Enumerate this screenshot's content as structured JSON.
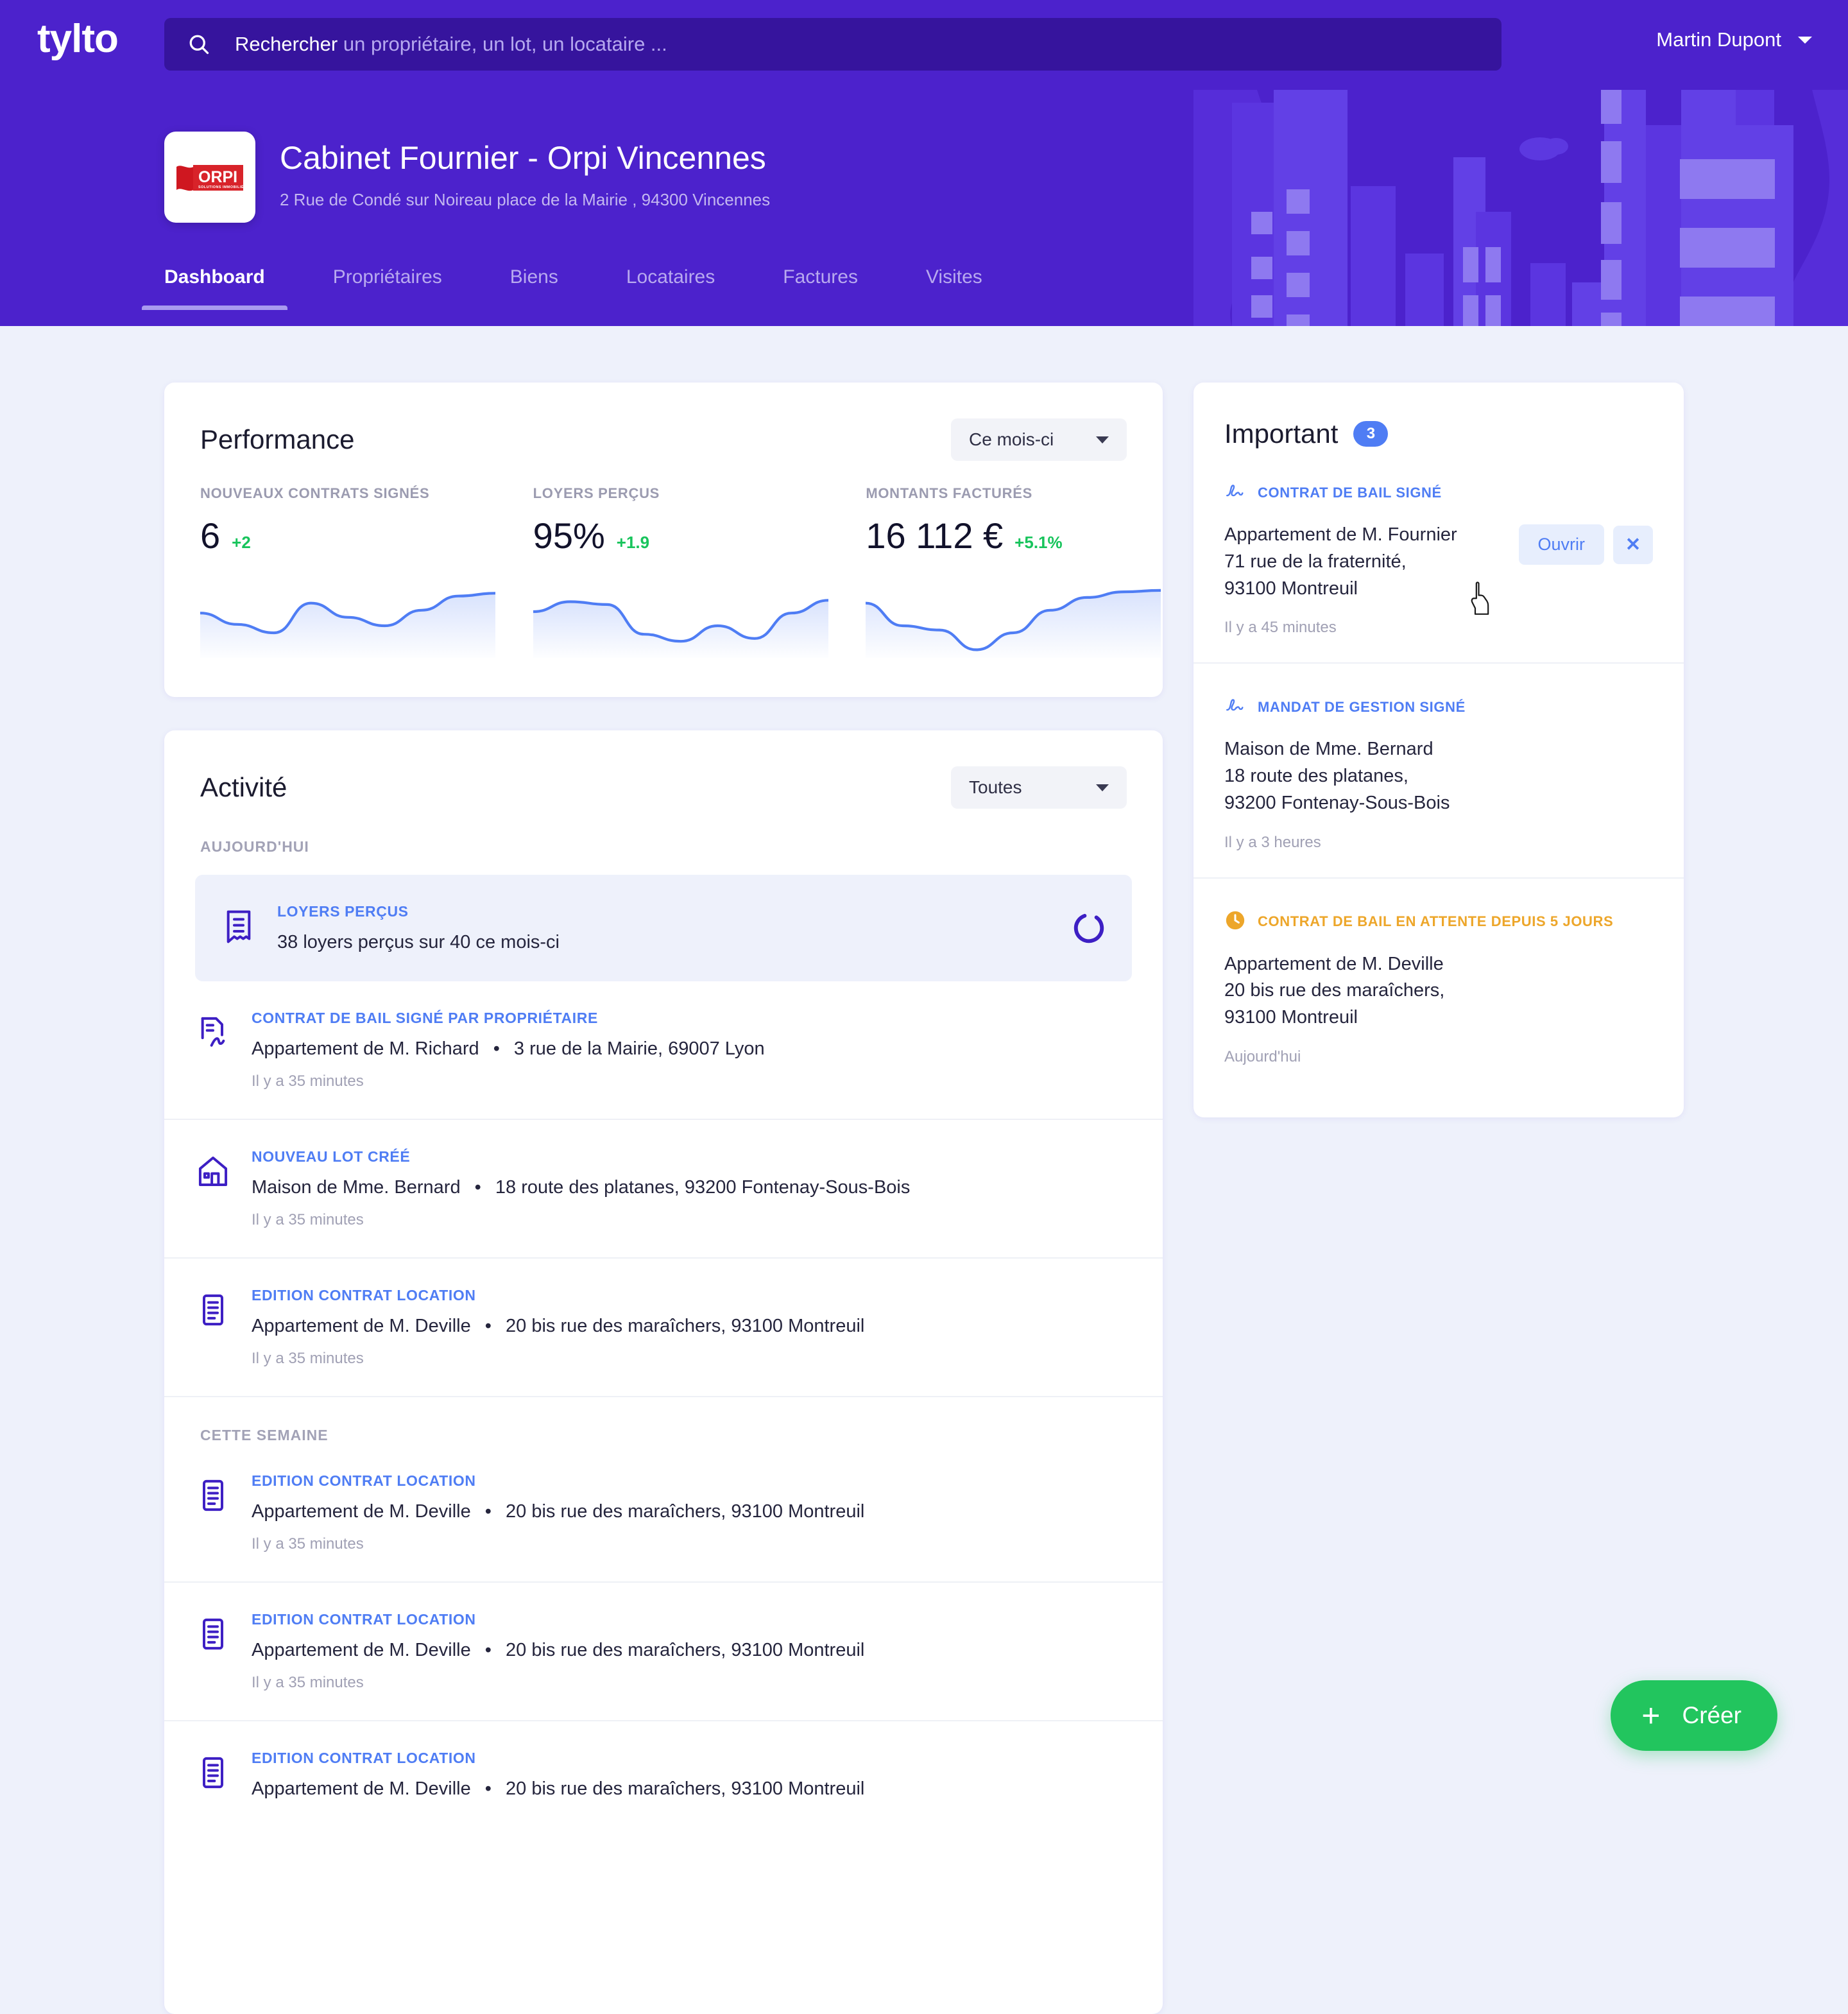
{
  "brand": {
    "logo_text": "tylto"
  },
  "search": {
    "label": "Rechercher",
    "placeholder": "un propriétaire, un lot, un locataire ...",
    "icon": "search-icon"
  },
  "user": {
    "name": "Martin Dupont",
    "caret_icon": "chevron-down-icon"
  },
  "agency": {
    "logo_alt": "ORPI",
    "logo_tagline": "SOLUTIONS IMMOBILIÈRES",
    "name": "Cabinet Fournier - Orpi Vincennes",
    "address": "2 Rue de Condé sur Noireau place de la Mairie , 94300 Vincennes"
  },
  "tabs": [
    {
      "label": "Dashboard",
      "active": true
    },
    {
      "label": "Propriétaires",
      "active": false
    },
    {
      "label": "Biens",
      "active": false
    },
    {
      "label": "Locataires",
      "active": false
    },
    {
      "label": "Factures",
      "active": false
    },
    {
      "label": "Visites",
      "active": false
    }
  ],
  "performance": {
    "title": "Performance",
    "period_selected": "Ce mois-ci",
    "kpis": [
      {
        "label": "NOUVEAUX CONTRATS SIGNÉS",
        "value": "6",
        "delta": "+2"
      },
      {
        "label": "LOYERS PERÇUS",
        "value": "95%",
        "delta": "+1.9"
      },
      {
        "label": "MONTANTS FACTURÉS",
        "value": "16 112 €",
        "delta": "+5.1%"
      }
    ]
  },
  "chart_data": [
    {
      "type": "line",
      "title": "NOUVEAUX CONTRATS SIGNÉS",
      "x": [
        0,
        1,
        2,
        3,
        4,
        5,
        6,
        7,
        8
      ],
      "values": [
        58,
        42,
        30,
        72,
        52,
        40,
        62,
        82,
        86
      ],
      "ylim": [
        0,
        100
      ],
      "xlabel": "",
      "ylabel": "",
      "grid": false,
      "legend": "none",
      "line_color": "#4f7df4",
      "fill": "gradient"
    },
    {
      "type": "line",
      "title": "LOYERS PERÇUS",
      "x": [
        0,
        1,
        2,
        3,
        4,
        5,
        6,
        7,
        8
      ],
      "values": [
        60,
        74,
        70,
        28,
        18,
        40,
        22,
        58,
        76
      ],
      "ylim": [
        0,
        100
      ],
      "xlabel": "",
      "ylabel": "",
      "grid": false,
      "legend": "none",
      "line_color": "#4f7df4",
      "fill": "gradient"
    },
    {
      "type": "line",
      "title": "MONTANTS FACTURÉS",
      "x": [
        0,
        1,
        2,
        3,
        4,
        5,
        6,
        7,
        8
      ],
      "values": [
        72,
        40,
        34,
        6,
        30,
        62,
        80,
        88,
        90
      ],
      "ylim": [
        0,
        100
      ],
      "xlabel": "",
      "ylabel": "",
      "grid": false,
      "legend": "none",
      "line_color": "#4f7df4",
      "fill": "gradient"
    }
  ],
  "activity": {
    "title": "Activité",
    "filter_selected": "Toutes",
    "groups": [
      {
        "label": "AUJOURD'HUI",
        "highlight": {
          "icon": "receipt-icon",
          "kind": "LOYERS PERÇUS",
          "text": "38 loyers perçus sur 40 ce mois-ci",
          "status_icon": "loading-spinner-icon"
        },
        "items": [
          {
            "icon": "contract-signed-icon",
            "kind": "CONTRAT DE BAIL SIGNÉ PAR PROPRIÉTAIRE",
            "subject": "Appartement de M. Richard",
            "address": "3 rue de la Mairie, 69007 Lyon",
            "time": "Il y a 35 minutes"
          },
          {
            "icon": "house-icon",
            "kind": "NOUVEAU LOT CRÉÉ",
            "subject": "Maison de Mme. Bernard",
            "address": "18 route des platanes, 93200 Fontenay-Sous-Bois",
            "time": "Il y a 35 minutes"
          },
          {
            "icon": "document-icon",
            "kind": "EDITION CONTRAT LOCATION",
            "subject": "Appartement de M. Deville",
            "address": "20 bis rue des maraîchers, 93100 Montreuil",
            "time": "Il y a 35 minutes"
          }
        ]
      },
      {
        "label": "CETTE SEMAINE",
        "items": [
          {
            "icon": "document-icon",
            "kind": "EDITION CONTRAT LOCATION",
            "subject": "Appartement de M. Deville",
            "address": "20 bis rue des maraîchers, 93100 Montreuil",
            "time": "Il y a 35 minutes"
          },
          {
            "icon": "document-icon",
            "kind": "EDITION CONTRAT LOCATION",
            "subject": "Appartement de M. Deville",
            "address": "20 bis rue des maraîchers, 93100 Montreuil",
            "time": "Il y a 35 minutes"
          },
          {
            "icon": "document-icon",
            "kind": "EDITION CONTRAT LOCATION",
            "subject": "Appartement de M. Deville",
            "address": "20 bis rue des maraîchers, 93100 Montreuil",
            "time": ""
          }
        ]
      }
    ]
  },
  "important": {
    "title": "Important",
    "count": "3",
    "items": [
      {
        "icon": "signature-icon",
        "kind": "CONTRAT DE BAIL SIGNÉ",
        "kind_style": "info",
        "line1": "Appartement de M. Fournier",
        "line2": "71 rue de la fraternité,",
        "line3": "93100 Montreuil",
        "time": "Il y a 45 minutes",
        "open_label": "Ouvrir",
        "close_label": "✕"
      },
      {
        "icon": "signature-icon",
        "kind": "MANDAT DE GESTION SIGNÉ",
        "kind_style": "info",
        "line1": "Maison de Mme. Bernard",
        "line2": "18 route des platanes,",
        "line3": "93200 Fontenay-Sous-Bois",
        "time": "Il y a 3 heures"
      },
      {
        "icon": "clock-icon",
        "kind": "CONTRAT DE BAIL EN ATTENTE DEPUIS 5 JOURS",
        "kind_style": "warn",
        "line1": "Appartement de M. Deville",
        "line2": "20 bis rue des maraîchers,",
        "line3": "93100 Montreuil",
        "time": "Aujourd'hui"
      }
    ]
  },
  "fab": {
    "label": "Créer",
    "icon": "plus-icon"
  },
  "colors": {
    "brand_purple": "#4c22cc",
    "accent_blue": "#4f7df4",
    "success_green": "#18c45c",
    "warning_amber": "#eda62a",
    "fab_green": "#22c55e",
    "page_bg": "#eef1fb"
  }
}
